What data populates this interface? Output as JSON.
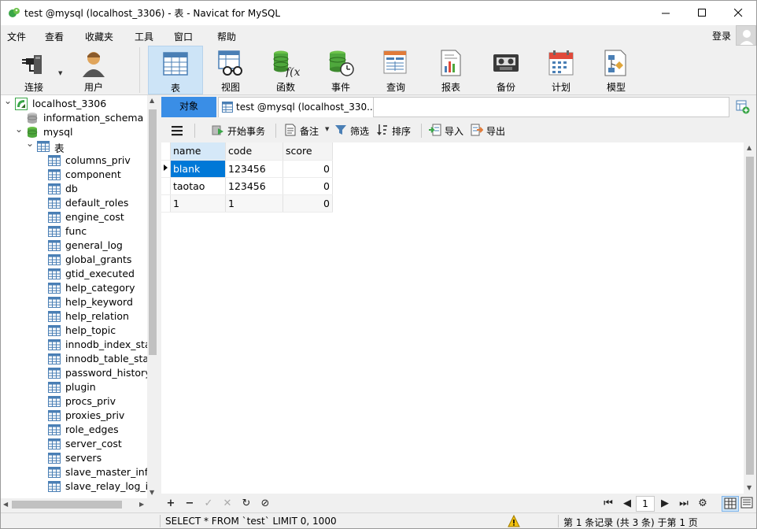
{
  "window": {
    "title": "test @mysql (localhost_3306) - 表 - Navicat for MySQL",
    "brand_color": "#3aa648"
  },
  "menu": [
    "文件",
    "查看",
    "收藏夹",
    "工具",
    "窗口",
    "帮助"
  ],
  "login_label": "登录",
  "toolbar": {
    "items": [
      {
        "label": "连接",
        "icon": "plug-icon"
      },
      {
        "label": "用户",
        "icon": "user-icon"
      },
      {
        "label": "表",
        "icon": "table-icon",
        "active": true
      },
      {
        "label": "视图",
        "icon": "view-icon"
      },
      {
        "label": "函数",
        "icon": "function-icon"
      },
      {
        "label": "事件",
        "icon": "event-icon"
      },
      {
        "label": "查询",
        "icon": "query-icon"
      },
      {
        "label": "报表",
        "icon": "report-icon"
      },
      {
        "label": "备份",
        "icon": "backup-icon"
      },
      {
        "label": "计划",
        "icon": "schedule-icon"
      },
      {
        "label": "模型",
        "icon": "model-icon"
      }
    ]
  },
  "tree": {
    "connection": "localhost_3306",
    "databases": [
      "information_schema",
      "mysql"
    ],
    "tables_node": "表",
    "tables": [
      "columns_priv",
      "component",
      "db",
      "default_roles",
      "engine_cost",
      "func",
      "general_log",
      "global_grants",
      "gtid_executed",
      "help_category",
      "help_keyword",
      "help_relation",
      "help_topic",
      "innodb_index_stat",
      "innodb_table_stat",
      "password_history",
      "plugin",
      "procs_priv",
      "proxies_priv",
      "role_edges",
      "server_cost",
      "servers",
      "slave_master_info",
      "slave_relay_log_in"
    ]
  },
  "tabs": {
    "objects": "对象",
    "query": "test @mysql (localhost_330..."
  },
  "data_toolbar": {
    "begin_tx": "开始事务",
    "memo": "备注",
    "filter": "筛选",
    "sort": "排序",
    "import": "导入",
    "export": "导出"
  },
  "grid": {
    "columns": [
      "name",
      "code",
      "score"
    ],
    "rows": [
      [
        "blank",
        "123456",
        "0"
      ],
      [
        "taotao",
        "123456",
        "0"
      ],
      [
        "1",
        "1",
        "0"
      ]
    ]
  },
  "pager": {
    "page": "1"
  },
  "status": {
    "sql": "SELECT * FROM `test` LIMIT 0, 1000",
    "record": "第 1 条记录 (共 3 条) 于第 1 页"
  }
}
